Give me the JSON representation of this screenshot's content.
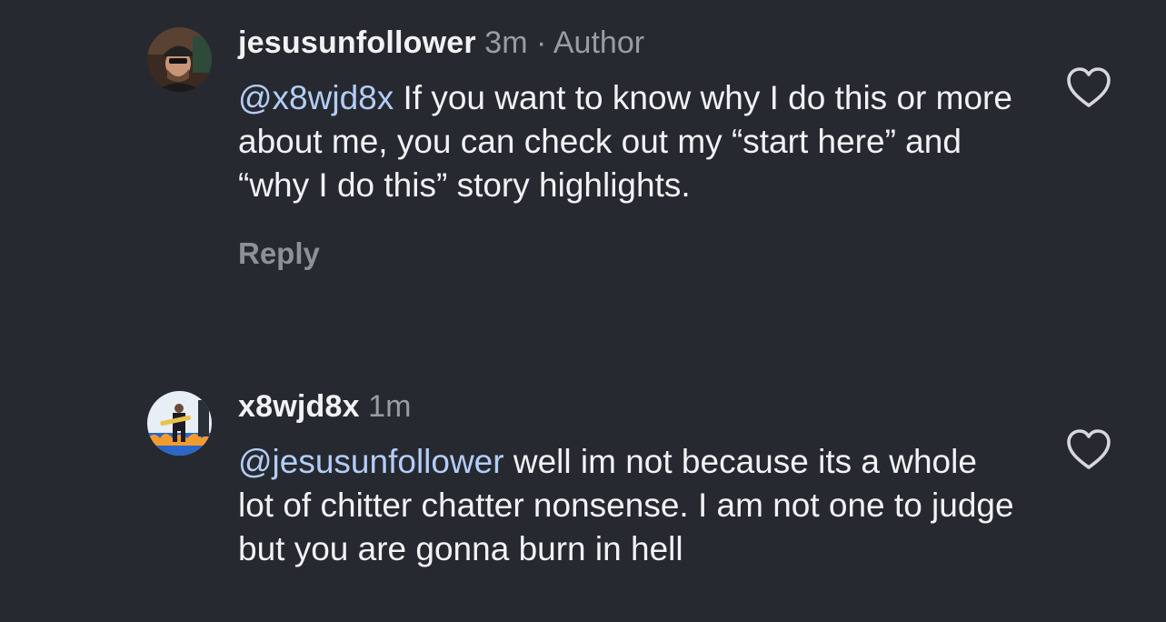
{
  "comments": [
    {
      "avatar_icon": "profile-photo-man-cap",
      "username": "jesusunfollower",
      "time": "3m",
      "separator": "·",
      "author_label": "Author",
      "mention": "@x8wjd8x",
      "text": " If you want to know why I do this or more about me, you can check out my “start here” and “why I do this” story highlights.",
      "reply_label": "Reply",
      "like_icon": "heart-outline-icon"
    },
    {
      "avatar_icon": "profile-photo-guitarist",
      "username": "x8wjd8x",
      "time": "1m",
      "mention": "@jesusunfollower",
      "text": " well im not because its a whole lot of chitter chatter nonsense. I am not one to judge but you are gonna burn in hell",
      "like_icon": "heart-outline-icon"
    }
  ],
  "colors": {
    "background": "#262930",
    "mention": "#b3cdf7",
    "muted": "#9a9ca3"
  }
}
